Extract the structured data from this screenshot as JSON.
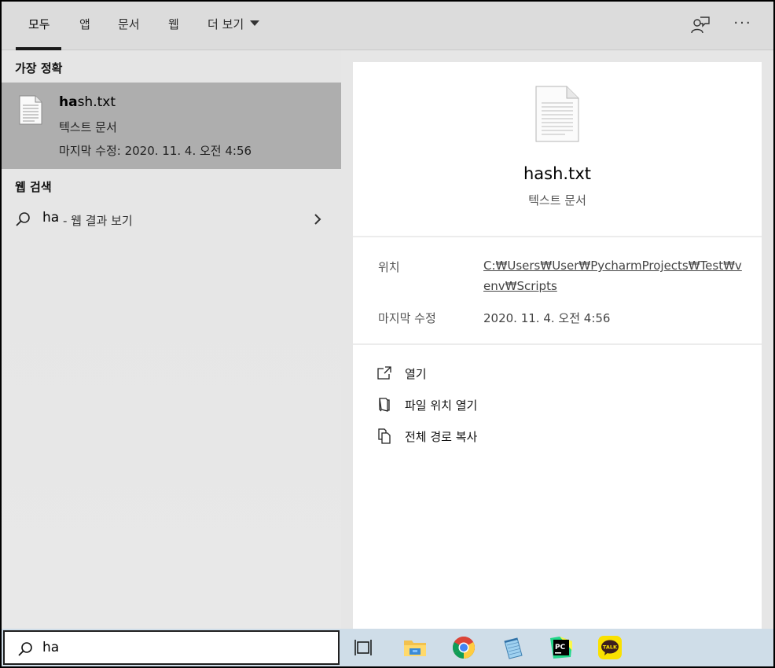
{
  "tabs": [
    {
      "label": "모두",
      "active": true
    },
    {
      "label": "앱"
    },
    {
      "label": "문서"
    },
    {
      "label": "웹"
    },
    {
      "label": "더 보기"
    }
  ],
  "toolbar": {
    "more_label": "···",
    "feedback_icon": "feedback-icon"
  },
  "best_match": {
    "section_label": "가장 정확",
    "file_name": "hash.txt",
    "file_name_bold": "ha",
    "file_name_rest": "sh.txt",
    "file_type": "텍스트 문서",
    "modified": "마지막 수정: 2020. 11. 4. 오전 4:56"
  },
  "web_search": {
    "section_label": "웹 검색",
    "query": "ha",
    "suffix": "- 웹 결과 보기"
  },
  "details": {
    "title": "hash.txt",
    "type": "텍스트 문서",
    "location_label": "위치",
    "location_value": "C:₩Users₩User₩PycharmProjects₩Test₩venv₩Scripts",
    "modified_label": "마지막 수정",
    "modified_value": "2020. 11. 4. 오전 4:56"
  },
  "actions": [
    {
      "label": "열기",
      "icon": "open-icon"
    },
    {
      "label": "파일 위치 열기",
      "icon": "folder-open-icon"
    },
    {
      "label": "전체 경로 복사",
      "icon": "copy-icon"
    }
  ],
  "taskbar": {
    "search_value": "ha",
    "apps": [
      "task-view-icon",
      "file-explorer-icon",
      "chrome-icon",
      "notepad-icon",
      "pycharm-icon",
      "kakaotalk-icon"
    ],
    "pycharm_label": "PC",
    "kakao_label": "TALK"
  }
}
